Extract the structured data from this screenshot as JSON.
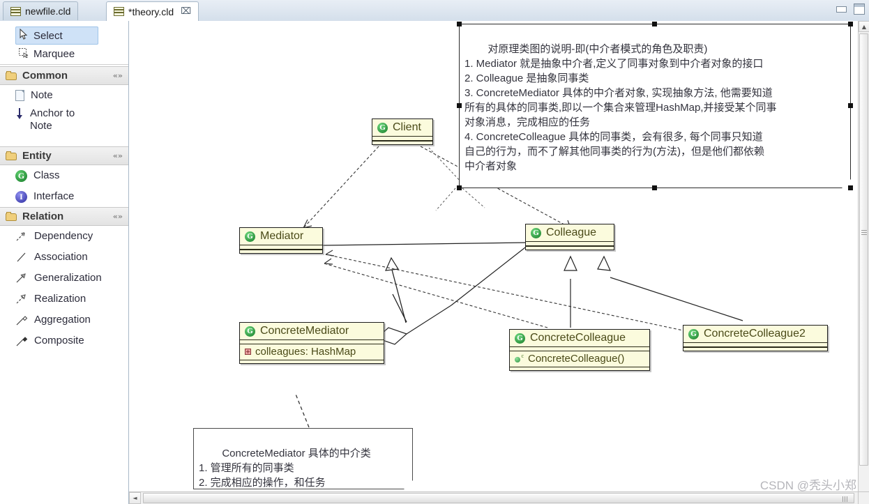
{
  "window": {
    "minimize_label": "Minimize",
    "maximize_label": "Restore"
  },
  "tabs": [
    {
      "label": "newfile.cld",
      "icon": "class-diagram-file-icon",
      "active": false,
      "modified": false
    },
    {
      "label": "*theory.cld",
      "icon": "class-diagram-file-icon",
      "active": true,
      "modified": true,
      "close_glyph": "⌧"
    }
  ],
  "palette": {
    "tools": [
      {
        "label": "Select",
        "icon": "pointer-icon",
        "selected": true
      },
      {
        "label": "Marquee",
        "icon": "marquee-icon",
        "selected": false
      }
    ],
    "groups": [
      {
        "title": "Common",
        "collapse_glyph": "«»",
        "items": [
          {
            "label": "Note",
            "icon": "note-icon"
          },
          {
            "label": "Anchor to Note",
            "icon": "anchor-arrow-icon"
          }
        ]
      },
      {
        "title": "Entity",
        "collapse_glyph": "«»",
        "items": [
          {
            "label": "Class",
            "icon": "class-icon",
            "glyph": "G"
          },
          {
            "label": "Interface",
            "icon": "interface-icon",
            "glyph": "I"
          }
        ]
      },
      {
        "title": "Relation",
        "collapse_glyph": "«»",
        "items": [
          {
            "label": "Dependency",
            "icon": "dependency-arrow-icon"
          },
          {
            "label": "Association",
            "icon": "association-line-icon"
          },
          {
            "label": "Generalization",
            "icon": "generalization-arrow-icon"
          },
          {
            "label": "Realization",
            "icon": "realization-arrow-icon"
          },
          {
            "label": "Aggregation",
            "icon": "aggregation-diamond-icon"
          },
          {
            "label": "Composite",
            "icon": "composite-diamond-icon"
          }
        ]
      }
    ]
  },
  "diagram": {
    "classes": [
      {
        "id": "client",
        "name": "Client",
        "members": []
      },
      {
        "id": "mediator",
        "name": "Mediator",
        "members": []
      },
      {
        "id": "colleague",
        "name": "Colleague",
        "members": []
      },
      {
        "id": "concrete_mediator",
        "name": "ConcreteMediator",
        "members": [
          {
            "text": "colleagues: HashMap",
            "kind": "field"
          }
        ]
      },
      {
        "id": "concrete_colleague",
        "name": "ConcreteColleague",
        "members": [
          {
            "text": "ConcreteColleague()",
            "kind": "method"
          }
        ]
      },
      {
        "id": "concrete_colleague2",
        "name": "ConcreteColleague2",
        "members": []
      }
    ],
    "notes": [
      {
        "id": "note_top",
        "selected": true,
        "text": "对原理类图的说明-即(中介者模式的角色及职责)\n1. Mediator 就是抽象中介者,定义了同事对象到中介者对象的接口\n2. Colleague 是抽象同事类\n3. ConcreteMediator 具体的中介者对象, 实现抽象方法, 他需要知道\n所有的具体的同事类,即以一个集合来管理HashMap,并接受某个同事\n对象消息，完成相应的任务\n4. ConcreteColleague 具体的同事类，会有很多, 每个同事只知道\n自己的行为，而不了解其他同事类的行为(方法)，但是他们都依赖\n中介者对象"
      },
      {
        "id": "note_bottom",
        "selected": false,
        "text": "ConcreteMediator 具体的中介类\n1. 管理所有的同事类\n2. 完成相应的操作，和任务"
      }
    ]
  },
  "watermark": "CSDN @秃头小郑",
  "scrollbars": {
    "vertical_up_glyph": "▲",
    "horizontal_left_glyph": "◄"
  },
  "colors": {
    "uml_fill": "#fbfbdd",
    "uml_border": "#1d1d1d",
    "uml_text": "#4a4a18",
    "palette_selection": "#cfe2f7",
    "class_icon_green": "#147a26",
    "interface_icon_blue": "#2b2b9e"
  }
}
